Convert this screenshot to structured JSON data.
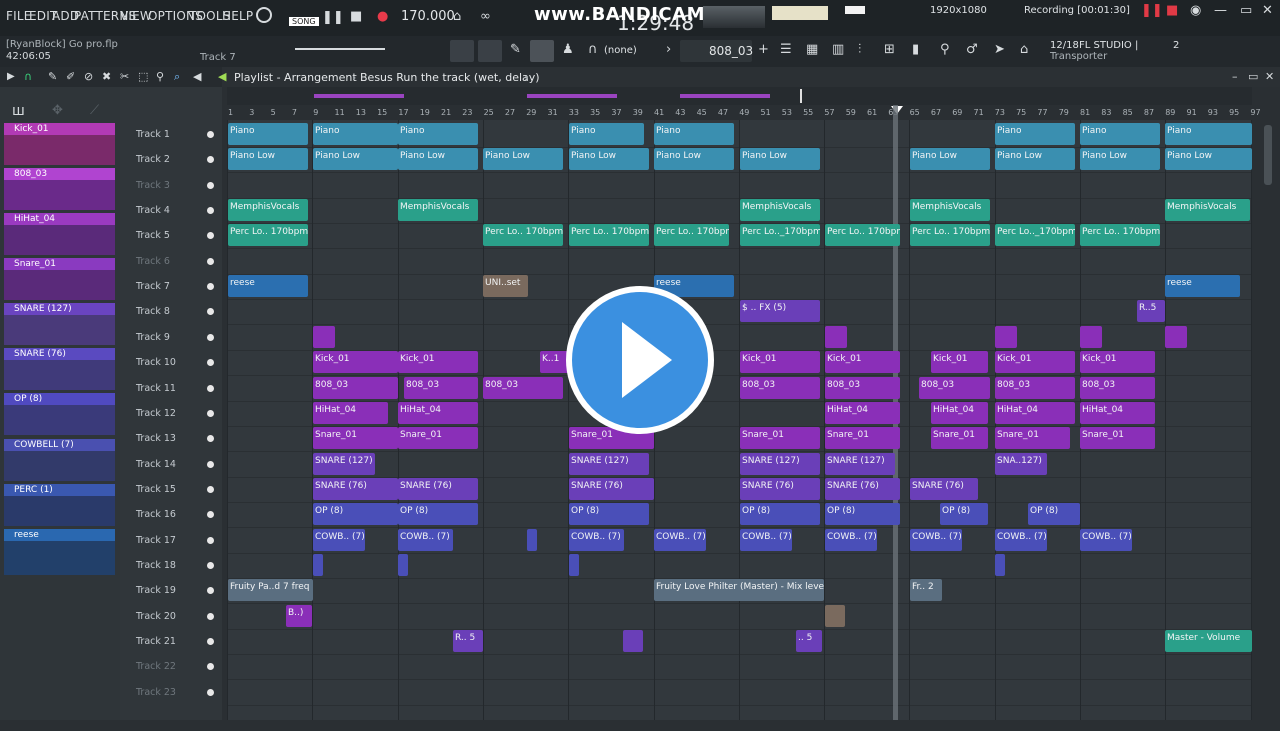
{
  "menu": [
    "FILE",
    "EDIT",
    "ADD",
    "PATTERNS",
    "VIEW",
    "OPTIONS",
    "TOOLS",
    "HELP"
  ],
  "transport": {
    "mode": "SONG",
    "tempo": "170.000",
    "time": "1:29:48"
  },
  "watermark": "www.BANDICAM.com",
  "recording": {
    "resolution": "1920x1080",
    "status": "Recording [00:01:30]"
  },
  "project": {
    "file": "[RyanBlock] Go pro.flp",
    "elapsed": "42:06:05",
    "hint_track": "Track 7"
  },
  "toolbar": {
    "snap": "(none)",
    "pattern": "808_03",
    "cpu": "12/18",
    "app": "FL STUDIO |",
    "app_sub": "Transporter",
    "badge": "2"
  },
  "playlist": {
    "title": "Playlist - Arrangement",
    "subtitle": "Besus Run the track (wet, delay)"
  },
  "ruler": [
    "1",
    "3",
    "5",
    "7",
    "9",
    "11",
    "13",
    "15",
    "17",
    "19",
    "21",
    "23",
    "25",
    "27",
    "29",
    "31",
    "33",
    "35",
    "37",
    "39",
    "41",
    "43",
    "45",
    "47",
    "49",
    "51",
    "53",
    "55",
    "57",
    "59",
    "61",
    "63",
    "65",
    "67",
    "69",
    "71",
    "73",
    "75",
    "77",
    "79",
    "81",
    "83",
    "85",
    "87",
    "89",
    "91",
    "93",
    "95",
    "97"
  ],
  "patterns": [
    "Kick_01",
    "808_03",
    "HiHat_04",
    "Snare_01",
    "SNARE (127)",
    "SNARE (76)",
    "OP (8)",
    "COWBELL (7)",
    "PERC (1)",
    "reese"
  ],
  "tracks": [
    "Track 1",
    "Track 2",
    "Track 3",
    "Track 4",
    "Track 5",
    "Track 6",
    "Track 7",
    "Track 8",
    "Track 9",
    "Track 10",
    "Track 11",
    "Track 12",
    "Track 13",
    "Track 14",
    "Track 15",
    "Track 16",
    "Track 17",
    "Track 18",
    "Track 19",
    "Track 20",
    "Track 21",
    "Track 22",
    "Track 23"
  ],
  "clip_labels": {
    "piano": "Piano",
    "piano_low": "Piano Low",
    "memphis": "MemphisVocals",
    "perc": "Perc Lo.. 170bpm",
    "perc_short": "Perc Lo.._170bpm",
    "reese": "reese",
    "uni": "UNI..set",
    "fx": "$ .. FX (5)",
    "r5": "R..5",
    "kick": "Kick_01",
    "k": "K..1",
    "b808": "808_03",
    "hihat": "HiHat_04",
    "snare": "Snare_01",
    "snare127": "SNARE (127)",
    "sna127": "SNA..127)",
    "snare76": "SNARE (76)",
    "op": "OP (8)",
    "cowb": "COWB.. (7)",
    "fruity_pad": "Fruity Pa..d 7 freq",
    "fruity_love": "Fruity Love Philter (Master) - Mix level",
    "fr2": "Fr.. 2",
    "b": "B..)",
    "r5b": "R.. 5",
    "s5": ".. 5",
    "master_vol": "Master - Volume"
  }
}
